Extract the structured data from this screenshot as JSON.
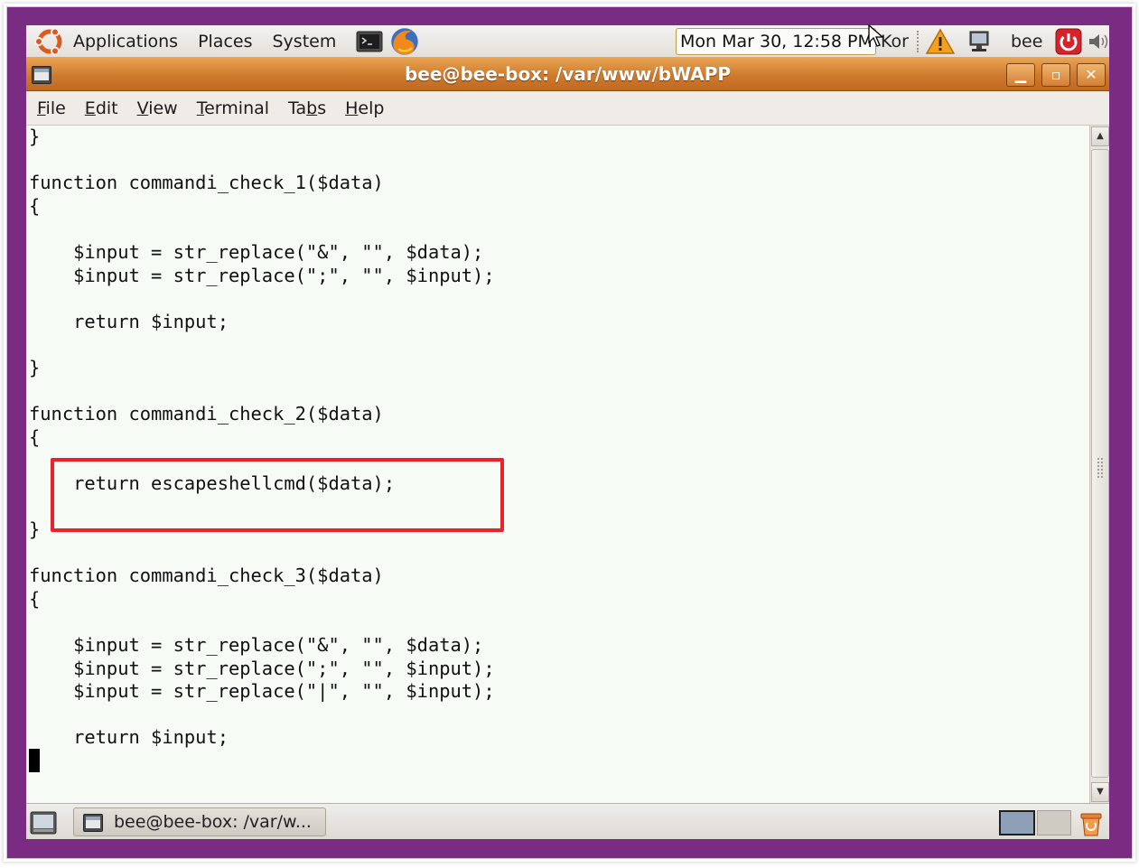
{
  "top_panel": {
    "menus": [
      "Applications",
      "Places",
      "System"
    ],
    "clock": "Mon Mar 30, 12:58 PM",
    "keyboard_layout": "Kor",
    "username": "bee"
  },
  "window": {
    "title": "bee@bee-box: /var/www/bWAPP",
    "buttons": [
      "minimize",
      "maximize",
      "close"
    ]
  },
  "menubar": {
    "items": [
      {
        "mnemonic": "F",
        "rest": "ile"
      },
      {
        "mnemonic": "E",
        "rest": "dit"
      },
      {
        "mnemonic": "V",
        "rest": "iew"
      },
      {
        "mnemonic": "T",
        "rest": "erminal"
      },
      {
        "pre": "Ta",
        "mnemonic": "b",
        "rest": "s"
      },
      {
        "mnemonic": "H",
        "rest": "elp"
      }
    ]
  },
  "terminal": {
    "lines": [
      "}",
      "",
      "function commandi_check_1($data)",
      "{",
      "",
      "    $input = str_replace(\"&\", \"\", $data);",
      "    $input = str_replace(\";\", \"\", $input);",
      "",
      "    return $input;",
      "",
      "}",
      "",
      "function commandi_check_2($data)",
      "{",
      "",
      "    return escapeshellcmd($data);",
      "",
      "}",
      "",
      "function commandi_check_3($data)",
      "{",
      "",
      "    $input = str_replace(\"&\", \"\", $data);",
      "    $input = str_replace(\";\", \"\", $input);",
      "    $input = str_replace(\"|\", \"\", $input);",
      "",
      "    return $input;",
      ""
    ],
    "highlight_color": "#e8232a",
    "background_color": "#f7fbf6"
  },
  "bottom_panel": {
    "task_label": "bee@bee-box: /var/w..."
  },
  "colors": {
    "desktop": "#7a2c82",
    "titlebar": "#cf7a2d",
    "panel": "#e9e6e1"
  }
}
